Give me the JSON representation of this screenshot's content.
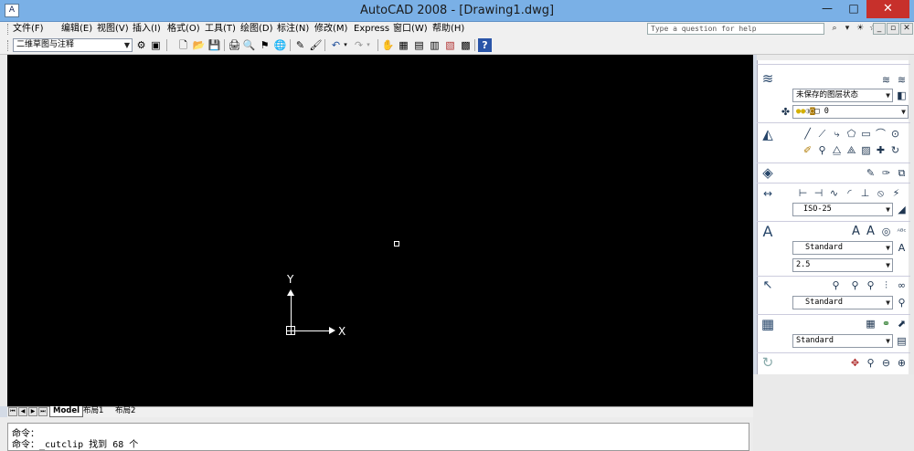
{
  "window": {
    "title": "AutoCAD 2008 - [Drawing1.dwg]",
    "app_icon_glyph": "A",
    "minimize": "—",
    "maximize": "□",
    "close": "✕"
  },
  "menu": {
    "items": [
      "文件(F)",
      "编辑(E)",
      "视图(V)",
      "插入(I)",
      "格式(O)",
      "工具(T)",
      "绘图(D)",
      "标注(N)",
      "修改(M)",
      "Express",
      "窗口(W)",
      "帮助(H)"
    ],
    "help_placeholder": "Type a question for help",
    "mdi_min": "_",
    "mdi_restore": "▫",
    "mdi_close": "✕"
  },
  "toolbar": {
    "workspace": "二维草图与注释"
  },
  "canvas": {
    "ucs_x": "X",
    "ucs_y": "Y",
    "background": "#000000",
    "crosshair_color": "#ffffff"
  },
  "layout_tabs": [
    "Model",
    "布局1",
    "布局2"
  ],
  "command": {
    "lines": [
      "命令：",
      "命令：_cutclip 找到 68 个"
    ]
  },
  "dashboard": {
    "layer_state": "未保存的图层状态",
    "layer_name": "0",
    "dimstyle": "ISO-25",
    "textstyle": "Standard",
    "textheight": "2.5",
    "mleaderstyle": "Standard",
    "tablestyle": "Standard"
  },
  "colors": {
    "title_bar": "#7ab0e6",
    "close_red": "#c7302b",
    "chrome": "#f0f0f0"
  }
}
